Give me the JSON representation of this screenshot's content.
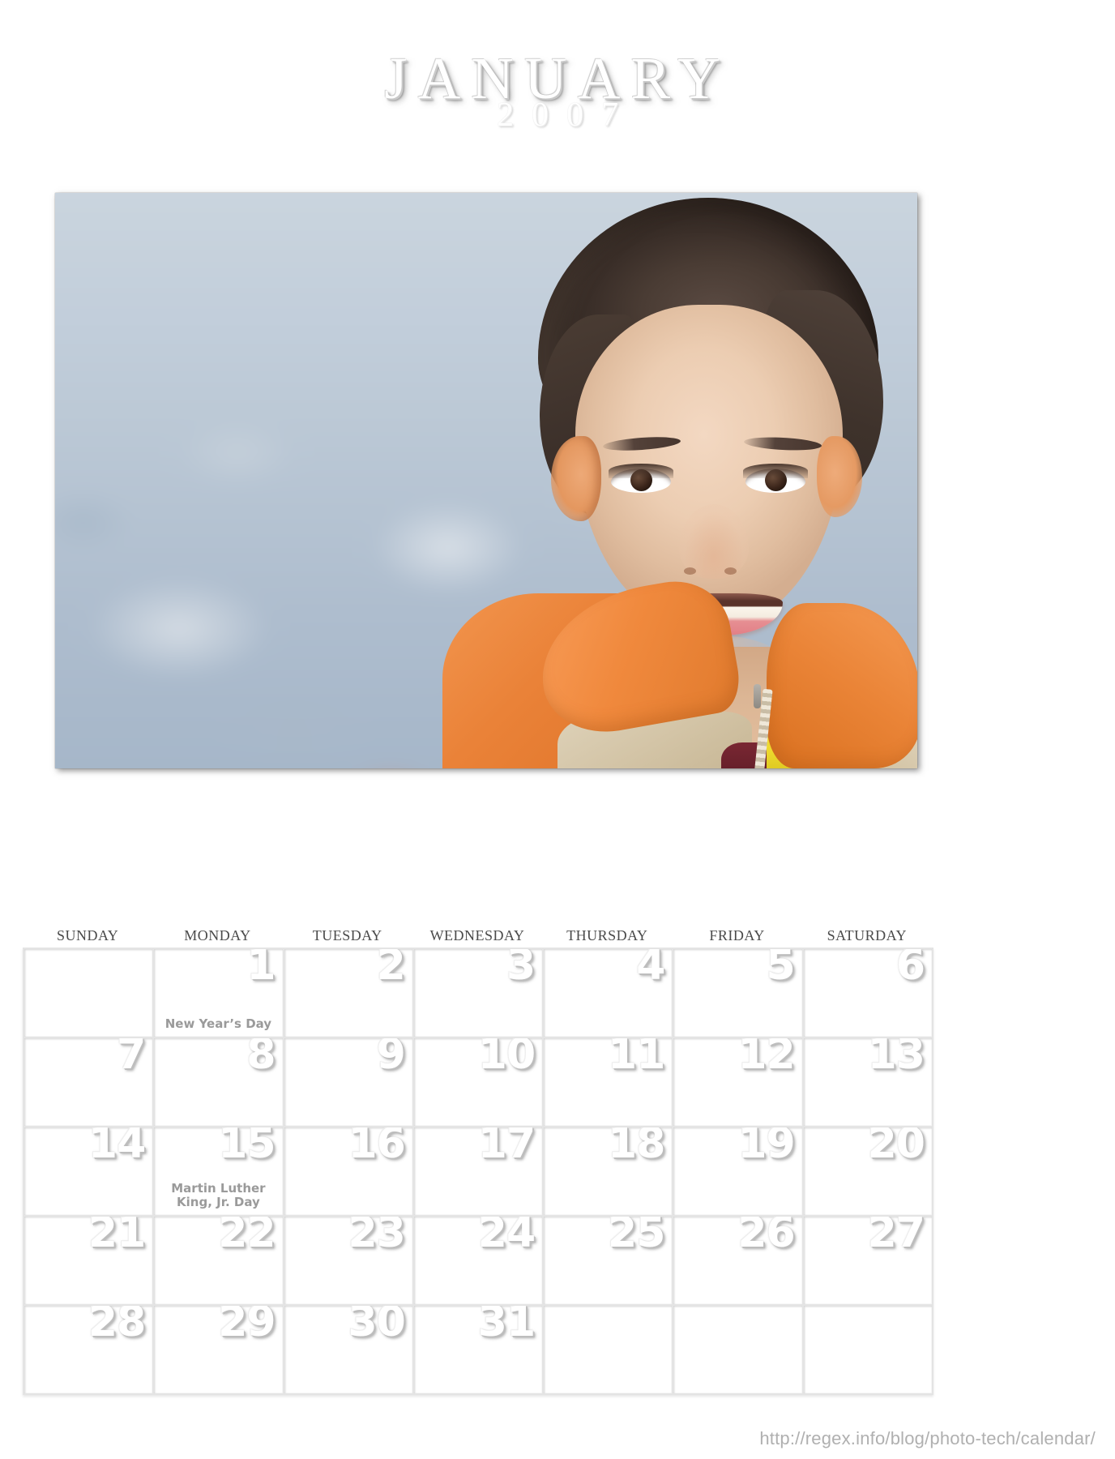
{
  "header": {
    "month": "January",
    "year": "2007"
  },
  "photo": {
    "alt_description": "Smiling young boy in an orange fleece jacket with a blurred cityscape behind him",
    "colors": {
      "jacket_orange": "#ea8238",
      "jacket_beige": "#d3c4a6",
      "shirt_yellow": "#ecd72c",
      "shirt_maroon": "#6c2330",
      "hair_brown": "#3b2f29",
      "background_blue_gray": "#bcc9d6"
    }
  },
  "calendar": {
    "weekdays": [
      "Sunday",
      "Monday",
      "Tuesday",
      "Wednesday",
      "Thursday",
      "Friday",
      "Saturday"
    ],
    "weeks": [
      [
        {
          "day": "",
          "holiday": ""
        },
        {
          "day": "1",
          "holiday": "New Year’s Day"
        },
        {
          "day": "2",
          "holiday": ""
        },
        {
          "day": "3",
          "holiday": ""
        },
        {
          "day": "4",
          "holiday": ""
        },
        {
          "day": "5",
          "holiday": ""
        },
        {
          "day": "6",
          "holiday": ""
        }
      ],
      [
        {
          "day": "7",
          "holiday": ""
        },
        {
          "day": "8",
          "holiday": ""
        },
        {
          "day": "9",
          "holiday": ""
        },
        {
          "day": "10",
          "holiday": ""
        },
        {
          "day": "11",
          "holiday": ""
        },
        {
          "day": "12",
          "holiday": ""
        },
        {
          "day": "13",
          "holiday": ""
        }
      ],
      [
        {
          "day": "14",
          "holiday": ""
        },
        {
          "day": "15",
          "holiday": "Martin Luther\nKing, Jr. Day"
        },
        {
          "day": "16",
          "holiday": ""
        },
        {
          "day": "17",
          "holiday": ""
        },
        {
          "day": "18",
          "holiday": ""
        },
        {
          "day": "19",
          "holiday": ""
        },
        {
          "day": "20",
          "holiday": ""
        }
      ],
      [
        {
          "day": "21",
          "holiday": ""
        },
        {
          "day": "22",
          "holiday": ""
        },
        {
          "day": "23",
          "holiday": ""
        },
        {
          "day": "24",
          "holiday": ""
        },
        {
          "day": "25",
          "holiday": ""
        },
        {
          "day": "26",
          "holiday": ""
        },
        {
          "day": "27",
          "holiday": ""
        }
      ],
      [
        {
          "day": "28",
          "holiday": ""
        },
        {
          "day": "29",
          "holiday": ""
        },
        {
          "day": "30",
          "holiday": ""
        },
        {
          "day": "31",
          "holiday": ""
        },
        {
          "day": "",
          "holiday": ""
        },
        {
          "day": "",
          "holiday": ""
        },
        {
          "day": "",
          "holiday": ""
        }
      ]
    ]
  },
  "footer": {
    "url": "http://regex.info/blog/photo-tech/calendar/"
  }
}
